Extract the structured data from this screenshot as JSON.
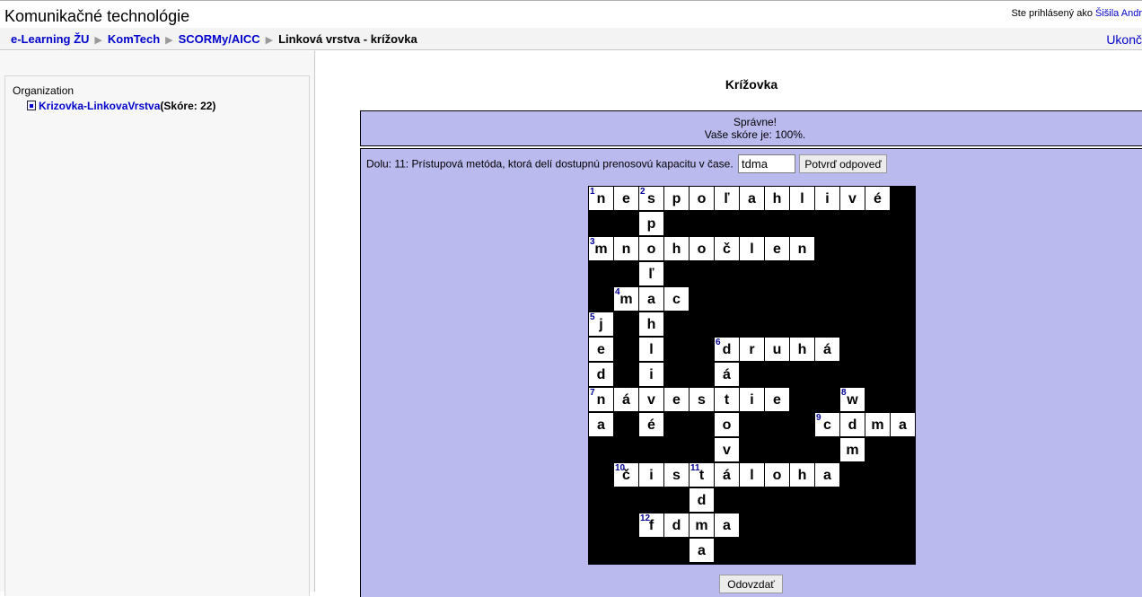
{
  "header": {
    "site_title": "Komunikačné technológie",
    "login_prefix": "Ste prihlásený ako",
    "user_name": "Šišila Andr"
  },
  "breadcrumb": {
    "items": [
      "e-Learning ŽU",
      "KomTech",
      "SCORMy/AICC"
    ],
    "current": "Linková vrstva - krížovka"
  },
  "logout_label": "Ukonč",
  "sidebar": {
    "title": "Organization",
    "item_label": "Krizovka-LinkovaVrstva",
    "item_score": "(Skóre: 22)"
  },
  "main": {
    "heading": "Krížovka",
    "feedback_line1": "Správne!",
    "feedback_line2": "Vaše skóre je: 100%.",
    "clue": "Dolu: 11: Prístupová metóda, ktorá delí dostupnú prenosovú kapacitu v čase.",
    "answer_value": "tdma",
    "confirm_label": "Potvrď odpoveď",
    "submit_label": "Odovzdať"
  },
  "crossword": {
    "rows": 15,
    "cols": 13,
    "cells": [
      {
        "r": 0,
        "c": 0,
        "ch": "n",
        "num": "1"
      },
      {
        "r": 0,
        "c": 1,
        "ch": "e"
      },
      {
        "r": 0,
        "c": 2,
        "ch": "s",
        "num": "2"
      },
      {
        "r": 0,
        "c": 3,
        "ch": "p"
      },
      {
        "r": 0,
        "c": 4,
        "ch": "o"
      },
      {
        "r": 0,
        "c": 5,
        "ch": "ľ"
      },
      {
        "r": 0,
        "c": 6,
        "ch": "a"
      },
      {
        "r": 0,
        "c": 7,
        "ch": "h"
      },
      {
        "r": 0,
        "c": 8,
        "ch": "l"
      },
      {
        "r": 0,
        "c": 9,
        "ch": "i"
      },
      {
        "r": 0,
        "c": 10,
        "ch": "v"
      },
      {
        "r": 0,
        "c": 11,
        "ch": "é"
      },
      {
        "r": 1,
        "c": 2,
        "ch": "p"
      },
      {
        "r": 2,
        "c": 0,
        "ch": "m",
        "num": "3"
      },
      {
        "r": 2,
        "c": 1,
        "ch": "n"
      },
      {
        "r": 2,
        "c": 2,
        "ch": "o"
      },
      {
        "r": 2,
        "c": 3,
        "ch": "h"
      },
      {
        "r": 2,
        "c": 4,
        "ch": "o"
      },
      {
        "r": 2,
        "c": 5,
        "ch": "č"
      },
      {
        "r": 2,
        "c": 6,
        "ch": "l"
      },
      {
        "r": 2,
        "c": 7,
        "ch": "e"
      },
      {
        "r": 2,
        "c": 8,
        "ch": "n"
      },
      {
        "r": 3,
        "c": 2,
        "ch": "ľ"
      },
      {
        "r": 4,
        "c": 1,
        "ch": "m",
        "num": "4"
      },
      {
        "r": 4,
        "c": 2,
        "ch": "a"
      },
      {
        "r": 4,
        "c": 3,
        "ch": "c"
      },
      {
        "r": 5,
        "c": 0,
        "ch": "j",
        "num": "5"
      },
      {
        "r": 5,
        "c": 2,
        "ch": "h"
      },
      {
        "r": 6,
        "c": 0,
        "ch": "e"
      },
      {
        "r": 6,
        "c": 2,
        "ch": "l"
      },
      {
        "r": 6,
        "c": 5,
        "ch": "d",
        "num": "6"
      },
      {
        "r": 6,
        "c": 6,
        "ch": "r"
      },
      {
        "r": 6,
        "c": 7,
        "ch": "u"
      },
      {
        "r": 6,
        "c": 8,
        "ch": "h"
      },
      {
        "r": 6,
        "c": 9,
        "ch": "á"
      },
      {
        "r": 7,
        "c": 0,
        "ch": "d"
      },
      {
        "r": 7,
        "c": 2,
        "ch": "i"
      },
      {
        "r": 7,
        "c": 5,
        "ch": "á"
      },
      {
        "r": 8,
        "c": 0,
        "ch": "n",
        "num": "7"
      },
      {
        "r": 8,
        "c": 1,
        "ch": "á"
      },
      {
        "r": 8,
        "c": 2,
        "ch": "v"
      },
      {
        "r": 8,
        "c": 3,
        "ch": "e"
      },
      {
        "r": 8,
        "c": 4,
        "ch": "s"
      },
      {
        "r": 8,
        "c": 5,
        "ch": "t"
      },
      {
        "r": 8,
        "c": 6,
        "ch": "i"
      },
      {
        "r": 8,
        "c": 7,
        "ch": "e"
      },
      {
        "r": 8,
        "c": 10,
        "ch": "w",
        "num": "8"
      },
      {
        "r": 9,
        "c": 0,
        "ch": "a"
      },
      {
        "r": 9,
        "c": 2,
        "ch": "é"
      },
      {
        "r": 9,
        "c": 5,
        "ch": "o"
      },
      {
        "r": 9,
        "c": 9,
        "ch": "c",
        "num": "9"
      },
      {
        "r": 9,
        "c": 10,
        "ch": "d"
      },
      {
        "r": 9,
        "c": 11,
        "ch": "m"
      },
      {
        "r": 9,
        "c": 12,
        "ch": "a"
      },
      {
        "r": 10,
        "c": 5,
        "ch": "v"
      },
      {
        "r": 10,
        "c": 10,
        "ch": "m"
      },
      {
        "r": 11,
        "c": 1,
        "ch": "č",
        "num": "10"
      },
      {
        "r": 11,
        "c": 2,
        "ch": "i"
      },
      {
        "r": 11,
        "c": 3,
        "ch": "s"
      },
      {
        "r": 11,
        "c": 4,
        "ch": "t",
        "num": "11"
      },
      {
        "r": 11,
        "c": 5,
        "ch": "á"
      },
      {
        "r": 11,
        "c": 6,
        "ch": "l"
      },
      {
        "r": 11,
        "c": 7,
        "ch": "o"
      },
      {
        "r": 11,
        "c": 8,
        "ch": "h"
      },
      {
        "r": 11,
        "c": 9,
        "ch": "a"
      },
      {
        "r": 12,
        "c": 4,
        "ch": "d"
      },
      {
        "r": 13,
        "c": 2,
        "ch": "f",
        "num": "12"
      },
      {
        "r": 13,
        "c": 3,
        "ch": "d"
      },
      {
        "r": 13,
        "c": 4,
        "ch": "m"
      },
      {
        "r": 13,
        "c": 5,
        "ch": "a"
      },
      {
        "r": 14,
        "c": 4,
        "ch": "a"
      }
    ]
  }
}
